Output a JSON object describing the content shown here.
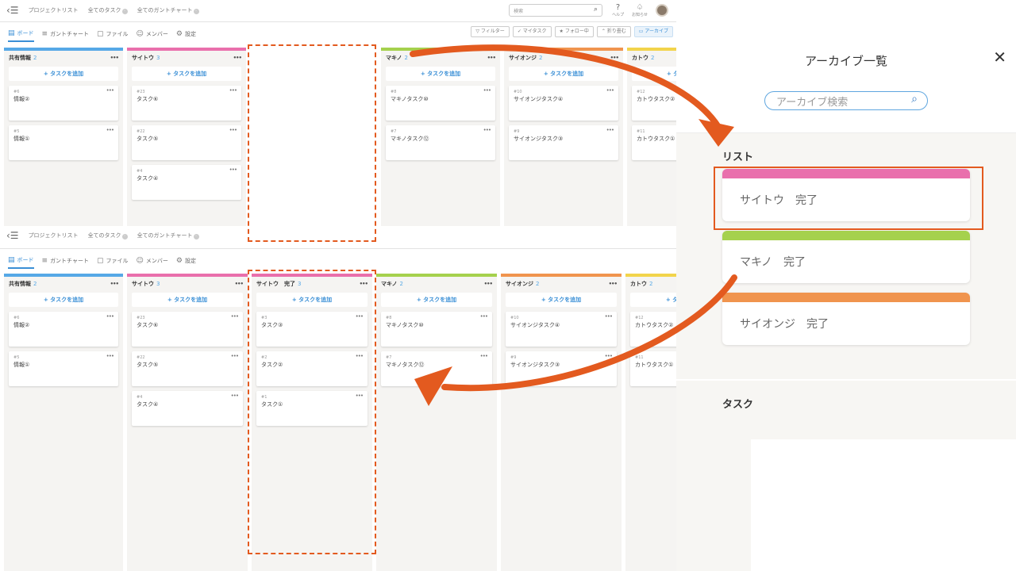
{
  "nav": {
    "project_list": "プロジェクトリスト",
    "all_tasks": "全てのタスク",
    "all_gantt": "全てのガントチャート"
  },
  "tabs": {
    "board": "ボード",
    "gantt": "ガントチャート",
    "file": "ファイル",
    "member": "メンバー",
    "settings": "設定"
  },
  "top_right": {
    "search_placeholder": "検索",
    "help": "ヘルプ",
    "notice": "お知らせ"
  },
  "filters": [
    "フィルター",
    "マイタスク",
    "フォロー中",
    "折り畳む",
    "アーカイブ"
  ],
  "add_task_label": "+ タスクを追加",
  "board_top": {
    "columns": [
      {
        "name": "共有情報",
        "count": "2",
        "color": "#56a8e6",
        "cards": [
          {
            "num": "#6",
            "title": "情報②"
          },
          {
            "num": "#5",
            "title": "情報①"
          }
        ]
      },
      {
        "name": "サイトウ",
        "count": "3",
        "color": "#e96fac",
        "cards": [
          {
            "num": "#23",
            "title": "タスク⑥"
          },
          {
            "num": "#22",
            "title": "タスク⑤"
          },
          {
            "num": "#4",
            "title": "タスク④"
          }
        ]
      },
      {
        "name": "",
        "count": "",
        "color": "#ffffff",
        "cards": []
      },
      {
        "name": "マキノ",
        "count": "2",
        "color": "#a5d14d",
        "cards": [
          {
            "num": "#8",
            "title": "マキノタスク⑩"
          },
          {
            "num": "#7",
            "title": "マキノタスク⑫"
          }
        ]
      },
      {
        "name": "サイオンジ",
        "count": "2",
        "color": "#f0944e",
        "cards": [
          {
            "num": "#10",
            "title": "サイオンジタスク④"
          },
          {
            "num": "#9",
            "title": "サイオンジタスク③"
          }
        ]
      },
      {
        "name": "カトウ",
        "count": "2",
        "color": "#f2d44b",
        "cards": [
          {
            "num": "#12",
            "title": "カトウタスク②"
          },
          {
            "num": "#11",
            "title": "カトウタスク①"
          }
        ]
      }
    ]
  },
  "board_bottom": {
    "columns": [
      {
        "name": "共有情報",
        "count": "2",
        "color": "#56a8e6",
        "cards": [
          {
            "num": "#6",
            "title": "情報②"
          },
          {
            "num": "#5",
            "title": "情報①"
          }
        ]
      },
      {
        "name": "サイトウ",
        "count": "3",
        "color": "#e96fac",
        "cards": [
          {
            "num": "#23",
            "title": "タスク⑥"
          },
          {
            "num": "#22",
            "title": "タスク⑤"
          },
          {
            "num": "#4",
            "title": "タスク④"
          }
        ]
      },
      {
        "name": "サイトウ　完了",
        "count": "3",
        "color": "#e96fac",
        "cards": [
          {
            "num": "#3",
            "title": "タスク③"
          },
          {
            "num": "#2",
            "title": "タスク②"
          },
          {
            "num": "#1",
            "title": "タスク①"
          }
        ]
      },
      {
        "name": "マキノ",
        "count": "2",
        "color": "#a5d14d",
        "cards": [
          {
            "num": "#8",
            "title": "マキノタスク⑩"
          },
          {
            "num": "#7",
            "title": "マキノタスク⑫"
          }
        ]
      },
      {
        "name": "サイオンジ",
        "count": "2",
        "color": "#f0944e",
        "cards": [
          {
            "num": "#10",
            "title": "サイオンジタスク④"
          },
          {
            "num": "#9",
            "title": "サイオンジタスク③"
          }
        ]
      },
      {
        "name": "カトウ",
        "count": "2",
        "color": "#f2d44b",
        "cards": [
          {
            "num": "#12",
            "title": "カトウタスク②"
          },
          {
            "num": "#11",
            "title": "カトウタスク①"
          }
        ]
      }
    ]
  },
  "archive": {
    "title": "アーカイブ一覧",
    "close": "✕",
    "search_placeholder": "アーカイブ検索",
    "section_list": "リスト",
    "section_task": "タスク",
    "lists": [
      {
        "label": "サイトウ　完了",
        "color": "#e96fac"
      },
      {
        "label": "マキノ　完了",
        "color": "#a5d14d"
      },
      {
        "label": "サイオンジ　完了",
        "color": "#f0944e"
      }
    ]
  },
  "accent_color": "#e35a1f"
}
